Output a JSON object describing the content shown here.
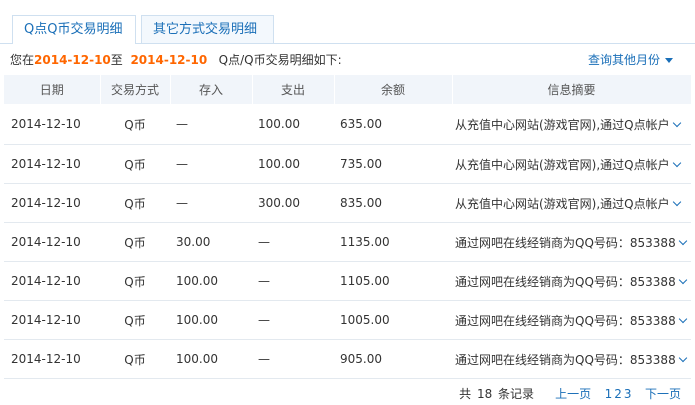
{
  "tabs": [
    {
      "label": "Q点Q币交易明细",
      "active": true
    },
    {
      "label": "其它方式交易明细",
      "active": false
    }
  ],
  "range": {
    "prefix": "您在",
    "start": "2014-12-10",
    "to": "至",
    "end": "2014-12-10",
    "suffix": "Q点/Q币交易明细如下:"
  },
  "query_link": "查询其他月份",
  "table": {
    "headers": [
      "日期",
      "交易方式",
      "存入",
      "支出",
      "余额",
      "信息摘要"
    ],
    "rows": [
      {
        "date": "2014-12-10",
        "mode": "Q币",
        "deposit": "—",
        "expense": "100.00",
        "balance": "635.00",
        "info": "从充值中心网站(游戏官网),通过Q点帐户"
      },
      {
        "date": "2014-12-10",
        "mode": "Q币",
        "deposit": "—",
        "expense": "100.00",
        "balance": "735.00",
        "info": "从充值中心网站(游戏官网),通过Q点帐户"
      },
      {
        "date": "2014-12-10",
        "mode": "Q币",
        "deposit": "—",
        "expense": "300.00",
        "balance": "835.00",
        "info": "从充值中心网站(游戏官网),通过Q点帐户"
      },
      {
        "date": "2014-12-10",
        "mode": "Q币",
        "deposit": "30.00",
        "expense": "—",
        "balance": "1135.00",
        "info": "通过网吧在线经销商为QQ号码：853388"
      },
      {
        "date": "2014-12-10",
        "mode": "Q币",
        "deposit": "100.00",
        "expense": "—",
        "balance": "1105.00",
        "info": "通过网吧在线经销商为QQ号码：853388"
      },
      {
        "date": "2014-12-10",
        "mode": "Q币",
        "deposit": "100.00",
        "expense": "—",
        "balance": "1005.00",
        "info": "通过网吧在线经销商为QQ号码：853388"
      },
      {
        "date": "2014-12-10",
        "mode": "Q币",
        "deposit": "100.00",
        "expense": "—",
        "balance": "905.00",
        "info": "通过网吧在线经销商为QQ号码：853388"
      }
    ]
  },
  "pager": {
    "total_prefix": "共",
    "total": "18",
    "total_suffix": "条记录",
    "prev": "上一页",
    "pages": [
      "1",
      "2",
      "3"
    ],
    "next": "下一页"
  },
  "colors": {
    "accent": "#1a6fb8",
    "date_highlight": "#ff6600",
    "header_bg": "#f1f5fa"
  }
}
